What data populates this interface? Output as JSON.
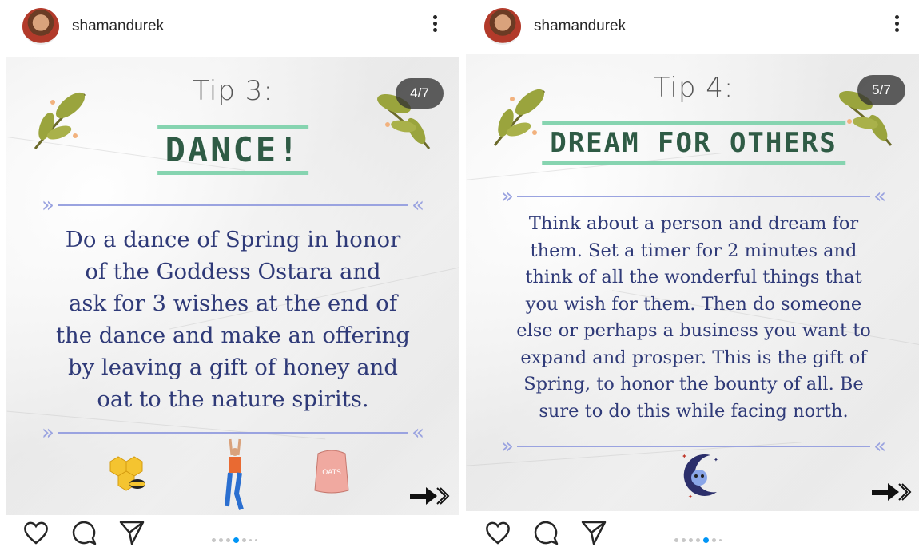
{
  "posts": [
    {
      "username": "shamandurek",
      "counter": "4/7",
      "tip_title": "Tip 3:",
      "headline": "DANCE!",
      "body_lines": [
        "Do a dance of Spring in honor",
        "of the Goddess Ostara and",
        "ask for 3 wishes at the end of",
        "the dance and make an offering",
        "by leaving a gift of honey and",
        "oat to the nature spirits."
      ],
      "illustrations": [
        "honeycomb-bee-icon",
        "dancer-icon",
        "oats-sack-icon"
      ],
      "oats_label": "OATS",
      "carousel": {
        "total_dots": 7,
        "active_index": 3
      }
    },
    {
      "username": "shamandurek",
      "counter": "5/7",
      "tip_title": "Tip 4:",
      "headline": "DREAM FOR OTHERS",
      "body_lines": [
        "Think about a person and dream for",
        "them. Set a timer for 2 minutes and",
        "think of all the wonderful things that",
        "you wish for them. Then do someone",
        "else or perhaps a business you want to",
        "expand and prosper. This is the gift of",
        "Spring, to honor the bounty of all. Be",
        "sure to do this while facing north."
      ],
      "illustrations": [
        "moon-creature-icon"
      ],
      "carousel": {
        "total_dots": 7,
        "active_index": 4
      }
    }
  ],
  "icons": {
    "like": "heart-icon",
    "comment": "comment-icon",
    "share": "send-icon",
    "more": "more-options-icon",
    "next": "next-arrow-icon"
  },
  "colors": {
    "headline_underline": "#86d4b0",
    "headline_text": "#2f5b45",
    "body_text": "#2f3a78",
    "divider": "#9aa3e0",
    "active_dot": "#0095f6"
  }
}
